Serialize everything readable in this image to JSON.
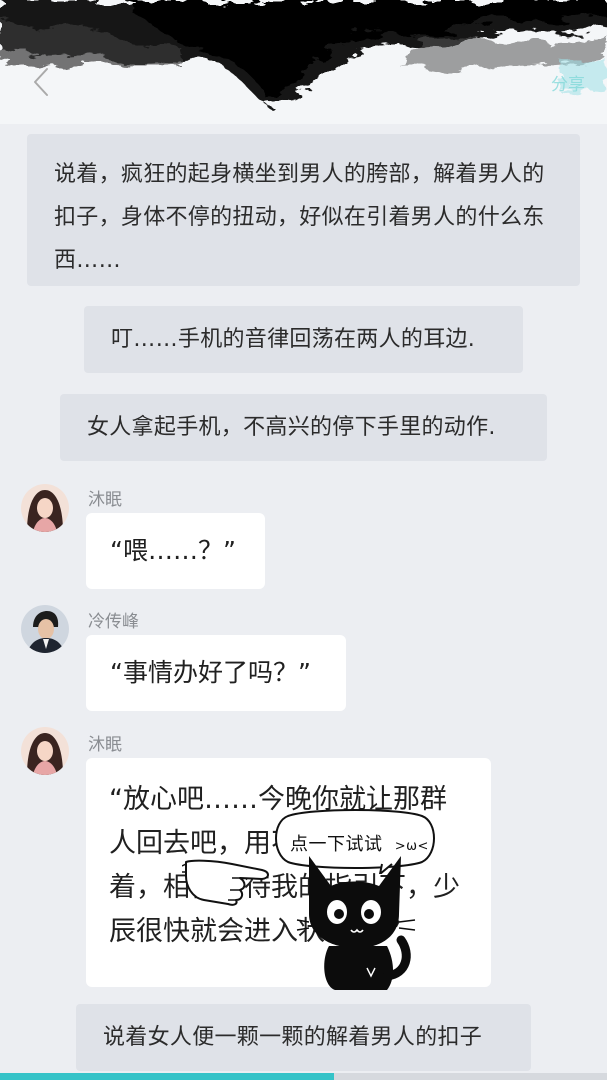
{
  "header": {
    "back_icon": "chevron-left-icon",
    "share_label": "分享"
  },
  "messages": {
    "narration1": "说着，疯狂的起身横坐到男人的胯部，解着男人的扣子，身体不停的扭动，好似在引着男人的什么东西……",
    "narration2": "叮……手机的音律回荡在两人的耳边.",
    "narration3": "女人拿起手机，不高兴的停下手里的动作.",
    "msg1": {
      "sender": "沐眠",
      "text": "“喂……？”"
    },
    "msg2": {
      "sender": "冷传峰",
      "text": "“事情办好了吗？”"
    },
    "msg3": {
      "sender": "沐眠",
      "text": "“放心吧……今晚你就让那群人回去吧，用不着在外面守着，相信，待我的指引下，少辰很快就会进入状态的.”"
    },
    "narration4": "说着女人便一颗一颗的解着男人的扣子"
  },
  "overlay": {
    "hint_text": "点一下试试",
    "hint_face": ">ω<"
  },
  "progress": {
    "fraction": 0.55
  },
  "colors": {
    "background": "#eceef2",
    "narration_bg": "#dfe2e8",
    "bubble_bg": "#ffffff",
    "accent": "#35c3c8"
  }
}
